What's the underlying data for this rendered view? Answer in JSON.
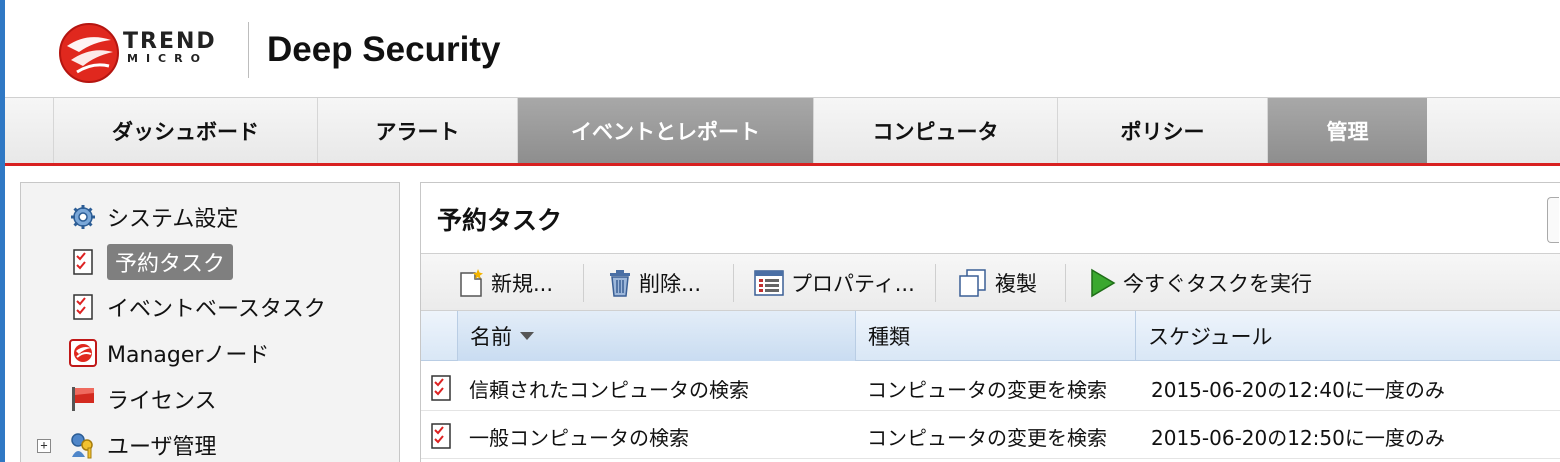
{
  "header": {
    "brand_trend": "TREND",
    "brand_micro": "MICRO",
    "product": "Deep Security"
  },
  "nav": {
    "tabs": [
      {
        "label": "ダッシュボード",
        "active": false
      },
      {
        "label": "アラート",
        "active": false
      },
      {
        "label": "イベントとレポート",
        "active": true
      },
      {
        "label": "コンピュータ",
        "active": false
      },
      {
        "label": "ポリシー",
        "active": false
      },
      {
        "label": "管理",
        "active": true
      }
    ]
  },
  "sidebar": {
    "items": [
      {
        "label": "システム設定",
        "icon": "gear-icon",
        "selected": false
      },
      {
        "label": "予約タスク",
        "icon": "task-icon",
        "selected": true
      },
      {
        "label": "イベントベースタスク",
        "icon": "task-icon",
        "selected": false
      },
      {
        "label": "Managerノード",
        "icon": "manager-node-icon",
        "selected": false
      },
      {
        "label": "ライセンス",
        "icon": "license-flag-icon",
        "selected": false
      },
      {
        "label": "ユーザ管理",
        "icon": "key-user-icon",
        "selected": false
      }
    ],
    "expand_symbol": "+"
  },
  "panel": {
    "title": "予約タスク",
    "toolbar": {
      "new": "新規...",
      "delete": "削除...",
      "properties": "プロパティ...",
      "duplicate": "複製",
      "run_now": "今すぐタスクを実行"
    },
    "table": {
      "columns": [
        "名前",
        "種類",
        "スケジュール"
      ],
      "rows": [
        [
          "信頼されたコンピュータの検索",
          "コンピュータの変更を検索",
          "2015-06-20の12:40に一度のみ"
        ],
        [
          "一般コンピュータの検索",
          "コンピュータの変更を検索",
          "2015-06-20の12:50に一度のみ"
        ]
      ]
    }
  },
  "colors": {
    "nav_accent": "#d82020",
    "active_tab": "#9a9a9a",
    "table_header": "#d9e7f6",
    "edge_strip": "#2f78c4"
  }
}
